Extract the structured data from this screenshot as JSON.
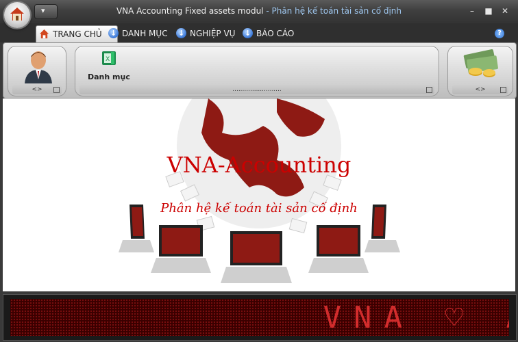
{
  "window": {
    "title_main": "VNA Accounting Fixed assets modul",
    "title_sep": " - ",
    "title_sub": "Phân hệ kế toán tài sản cố định",
    "controls": {
      "minimize": "–",
      "maximize": "■",
      "close": "✕"
    }
  },
  "qat": {
    "dropdown": "▾"
  },
  "tabs": [
    {
      "label": "TRANG CHỦ",
      "icon": "home-icon",
      "active": true
    },
    {
      "label": "DANH MỤC",
      "icon": "download-orb-icon"
    },
    {
      "label": "NGHIỆP VỤ",
      "icon": "download-orb-icon"
    },
    {
      "label": "BÁO CÁO",
      "icon": "download-orb-icon"
    }
  ],
  "help": "?",
  "ribbon": {
    "groups": [
      {
        "name": "user",
        "footer": "<>"
      },
      {
        "name": "catalog",
        "button_label": "Danh mục",
        "footer": "........................."
      },
      {
        "name": "money",
        "footer": "<>"
      }
    ]
  },
  "banner": {
    "title": "VNA-Accounting",
    "subtitle": "Phân hệ kế toán tài sản cố định"
  },
  "ticker": {
    "text": "VNA ♡ A"
  },
  "colors": {
    "brand_red": "#cc0000",
    "ribbon_gray": "#d6d6d6",
    "title_sub": "#9fc7ef"
  }
}
